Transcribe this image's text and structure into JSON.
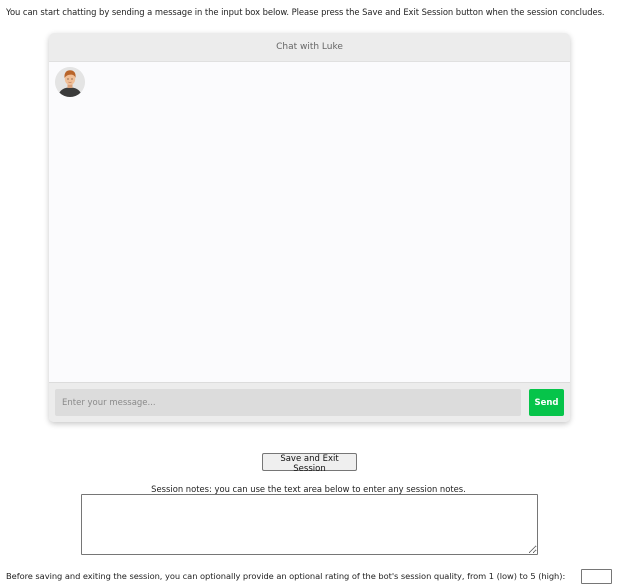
{
  "instructions": "You can start chatting by sending a message in the input box below. Please press the Save and Exit Session button when the session concludes.",
  "chat": {
    "title": "Chat with Luke",
    "avatar_icon": "user-avatar-icon",
    "input_value": "",
    "input_placeholder": "Enter your message...",
    "send_label": "Send"
  },
  "colors": {
    "send_button": "#06c44a",
    "header_background": "#ececec",
    "chat_background": "#fbfbfd"
  },
  "save_button_label": "Save and Exit Session",
  "notes": {
    "label": "Session notes: you can use the text area below to enter any session notes.",
    "value": ""
  },
  "rating": {
    "label": "Before saving and exiting the session, you can optionally provide an optional rating of the bot's session quality, from 1 (low) to 5 (high):",
    "value": ""
  }
}
